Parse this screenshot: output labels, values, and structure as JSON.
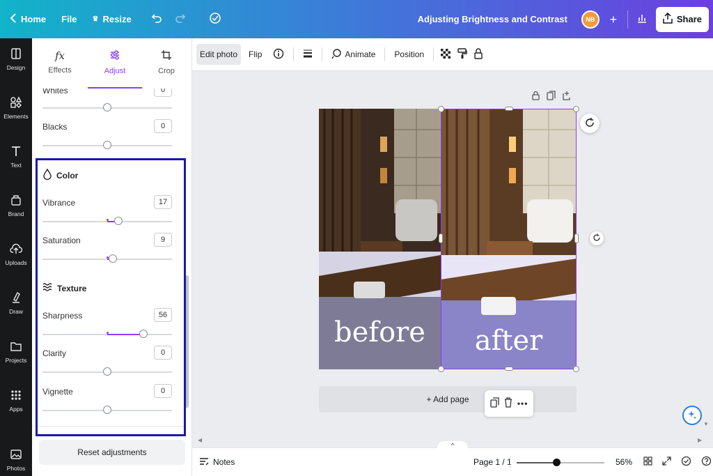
{
  "topbar": {
    "home_label": "Home",
    "file_label": "File",
    "resize_label": "Resize",
    "doc_title": "Adjusting Brightness and Contrast",
    "avatar_initials": "NB",
    "share_label": "Share",
    "icons": [
      "chevron-left-icon",
      "crown-icon",
      "undo-icon",
      "redo-icon",
      "cloud-check-icon",
      "plus-icon",
      "analytics-icon",
      "share-icon"
    ]
  },
  "rail": {
    "items": [
      {
        "label": "Design",
        "icon": "layout-icon"
      },
      {
        "label": "Elements",
        "icon": "shapes-icon"
      },
      {
        "label": "Text",
        "icon": "text-icon"
      },
      {
        "label": "Brand",
        "icon": "brand-icon"
      },
      {
        "label": "Uploads",
        "icon": "upload-cloud-icon"
      },
      {
        "label": "Draw",
        "icon": "draw-icon"
      },
      {
        "label": "Projects",
        "icon": "folder-icon"
      },
      {
        "label": "Apps",
        "icon": "apps-grid-icon"
      },
      {
        "label": "Photos",
        "icon": "photo-icon"
      }
    ]
  },
  "panel": {
    "tabs": [
      {
        "label": "Effects",
        "icon": "fx-icon"
      },
      {
        "label": "Adjust",
        "icon": "sliders-icon",
        "active": true
      },
      {
        "label": "Crop",
        "icon": "crop-icon"
      }
    ],
    "light": {
      "rows": [
        {
          "label": "Whites",
          "value": "0",
          "fraction": 0.5
        },
        {
          "label": "Blacks",
          "value": "0",
          "fraction": 0.5
        }
      ]
    },
    "color": {
      "title": "Color",
      "rows": [
        {
          "label": "Vibrance",
          "value": "17",
          "fraction": 0.585
        },
        {
          "label": "Saturation",
          "value": "9",
          "fraction": 0.545
        }
      ]
    },
    "texture": {
      "title": "Texture",
      "rows": [
        {
          "label": "Sharpness",
          "value": "56",
          "fraction": 0.78
        },
        {
          "label": "Clarity",
          "value": "0",
          "fraction": 0.5
        },
        {
          "label": "Vignette",
          "value": "0",
          "fraction": 0.5
        }
      ]
    },
    "reset_label": "Reset adjustments",
    "accent_color": "#8b3dff",
    "highlight_color": "#1a1aa8"
  },
  "toolbar": {
    "edit_photo": "Edit photo",
    "flip": "Flip",
    "animate": "Animate",
    "position": "Position"
  },
  "canvas": {
    "before_label": "before",
    "after_label": "after",
    "add_page_label": "+ Add page"
  },
  "bottombar": {
    "notes_label": "Notes",
    "page_indicator": "Page 1 / 1",
    "zoom_label": "56%",
    "zoom_fraction": 0.45
  }
}
